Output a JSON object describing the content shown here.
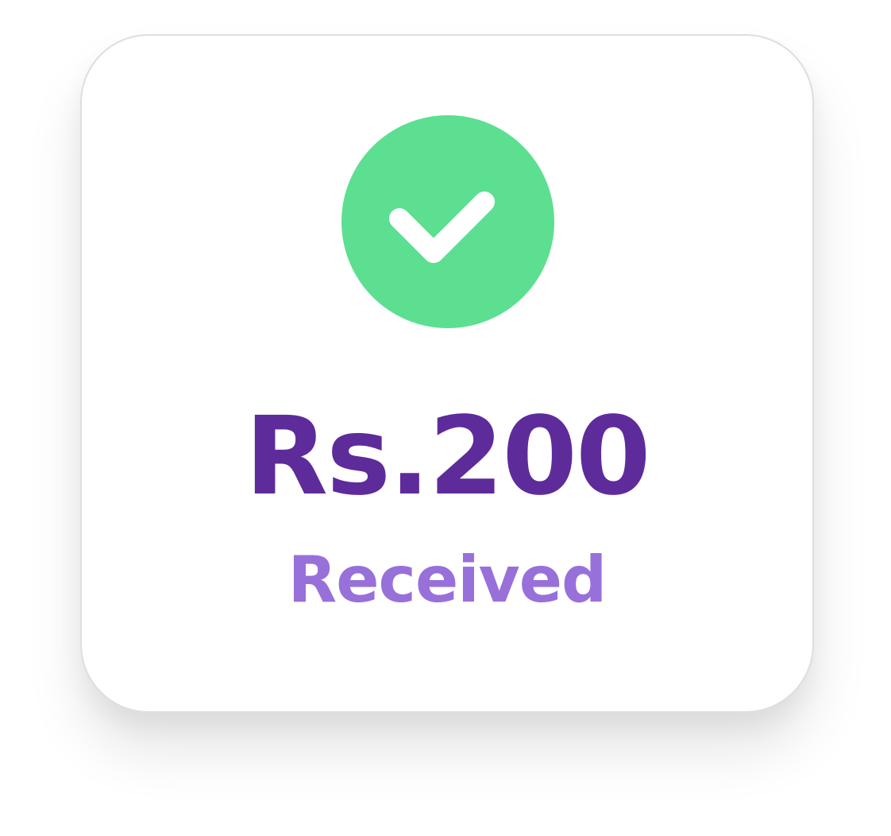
{
  "payment": {
    "amount": "Rs.200",
    "status": "Received",
    "icon": "check-circle-icon"
  },
  "colors": {
    "success": "#5cdf91",
    "amount_text": "#5e2b9b",
    "status_text": "#9870da",
    "card_background": "#ffffff",
    "card_border": "#dedede"
  }
}
